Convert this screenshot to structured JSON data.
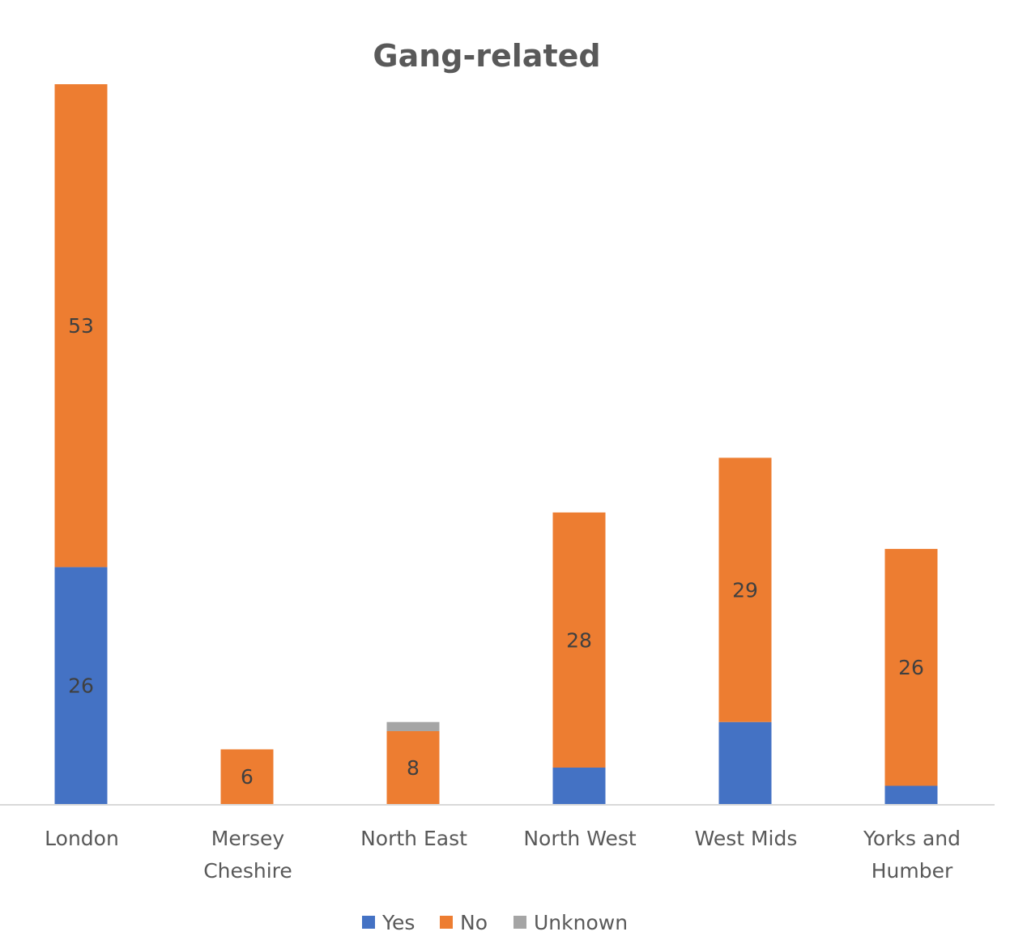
{
  "chart_data": {
    "type": "bar",
    "stacked": true,
    "title": "Gang-related",
    "xlabel": "",
    "ylabel": "",
    "ylim": [
      0,
      79
    ],
    "grid": false,
    "legend_position": "bottom",
    "categories": [
      [
        "London"
      ],
      [
        "Mersey",
        "Cheshire"
      ],
      [
        "North East"
      ],
      [
        "North West"
      ],
      [
        "West Mids"
      ],
      [
        "Yorks and",
        "Humber"
      ]
    ],
    "series": [
      {
        "name": "Yes",
        "color": "#4472c4",
        "values": [
          26,
          0,
          0,
          4,
          9,
          2
        ],
        "labels": [
          "26",
          "",
          "",
          "",
          "",
          ""
        ]
      },
      {
        "name": "No",
        "color": "#ed7d31",
        "values": [
          53,
          6,
          8,
          28,
          29,
          26
        ],
        "labels": [
          "53",
          "6",
          "8",
          "28",
          "29",
          "26"
        ]
      },
      {
        "name": "Unknown",
        "color": "#a5a5a5",
        "values": [
          0,
          0,
          1,
          0,
          0,
          0
        ],
        "labels": [
          "",
          "",
          "",
          "",
          "",
          ""
        ]
      }
    ],
    "axis_color": "#d9d9d9"
  }
}
